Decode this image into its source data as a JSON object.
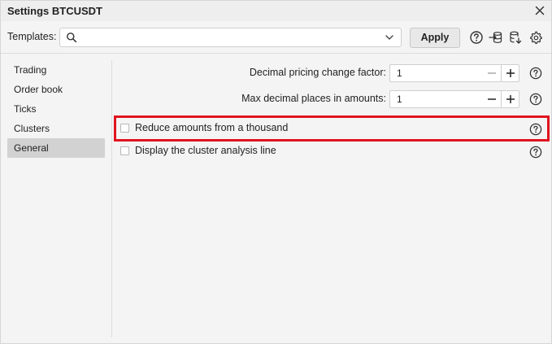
{
  "window": {
    "title": "Settings BTCUSDT",
    "close_icon": "close-icon"
  },
  "toolbar": {
    "templates_label": "Templates:",
    "templates_value": "",
    "apply_label": "Apply",
    "icons": [
      "help-circle-icon",
      "import-icon",
      "database-save-icon",
      "gear-icon"
    ]
  },
  "sidebar": {
    "items": [
      {
        "label": "Trading",
        "active": false
      },
      {
        "label": "Order book",
        "active": false
      },
      {
        "label": "Ticks",
        "active": false
      },
      {
        "label": "Clusters",
        "active": false
      },
      {
        "label": "General",
        "active": true
      }
    ]
  },
  "fields": [
    {
      "label": "Decimal pricing change factor:",
      "value": "1"
    },
    {
      "label": "Max decimal places in amounts:",
      "value": "1"
    }
  ],
  "checkboxes": [
    {
      "label": "Reduce amounts from a thousand",
      "checked": false,
      "highlighted": true
    },
    {
      "label": "Display the cluster analysis line",
      "checked": false,
      "highlighted": false
    }
  ],
  "colors": {
    "highlight": "#e0141e",
    "active_item_bg": "#d2d2d2"
  }
}
